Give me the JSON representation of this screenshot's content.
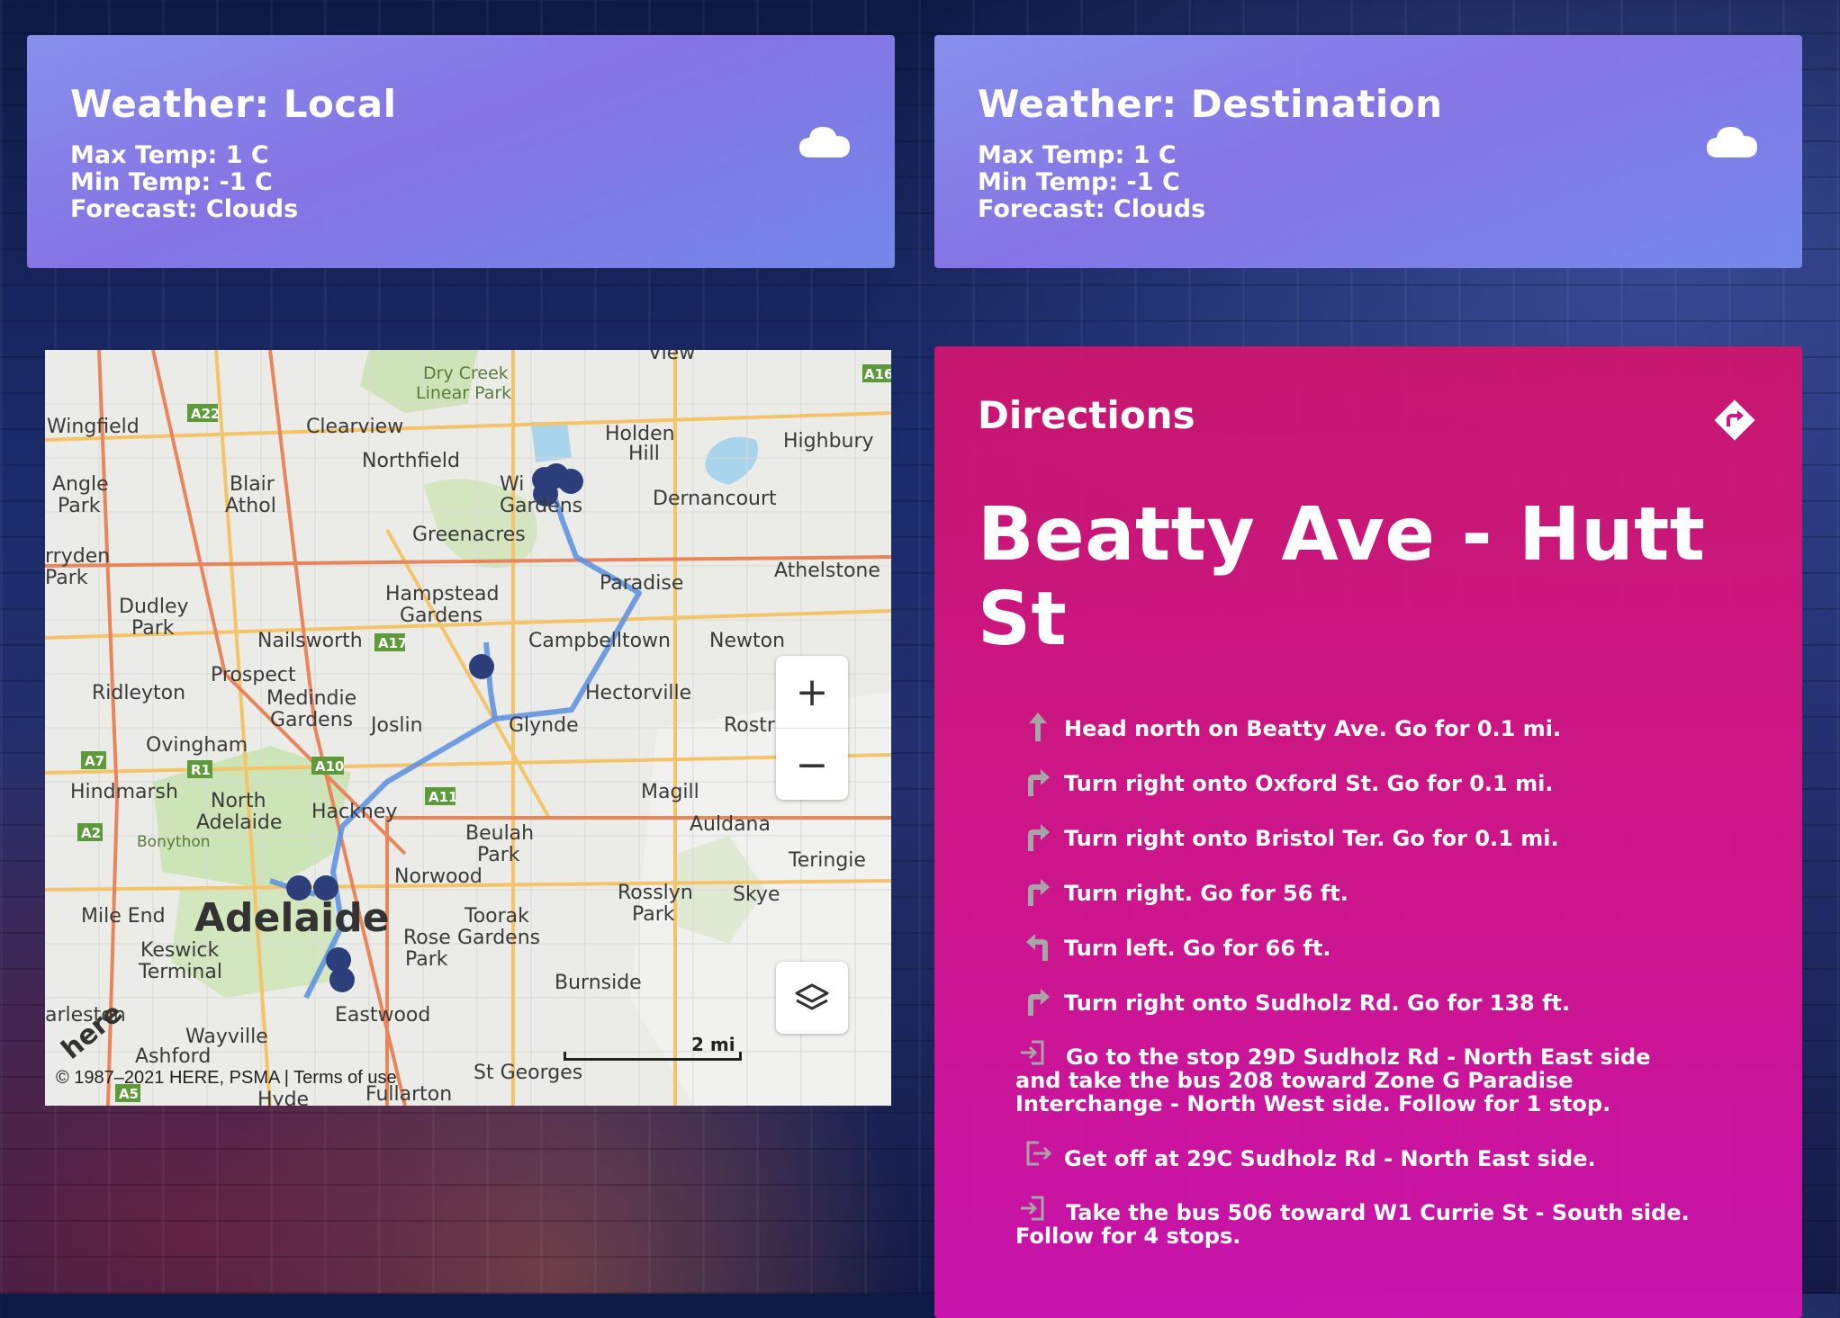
{
  "weather_local": {
    "title": "Weather: Local",
    "max_temp": "Max Temp: 1 C",
    "min_temp": "Min Temp: -1 C",
    "forecast": "Forecast: Clouds",
    "icon": "cloud-icon"
  },
  "weather_destination": {
    "title": "Weather: Destination",
    "max_temp": "Max Temp: 1 C",
    "min_temp": "Min Temp: -1 C",
    "forecast": "Forecast: Clouds",
    "icon": "cloud-icon"
  },
  "map": {
    "labels": {
      "dry_creek": "Dry Creek",
      "linear_park": "Linear Park",
      "wingfield": "Wingfield",
      "clearview": "Clearview",
      "holden": "Holden",
      "hill": "Hill",
      "highbury": "Highbury",
      "northfield": "Northfield",
      "angle": "Angle",
      "park": "Park",
      "blair": "Blair",
      "athol": "Athol",
      "gardens": "Gardens",
      "dernancourt": "Dernancourt",
      "greenacres": "Greenacres",
      "athelstone": "Athelstone",
      "ryden": "rryden",
      "dudley": "Dudley",
      "hampstead": "Hampstead",
      "paradise": "Paradise",
      "nailsworth": "Nailsworth",
      "campbelltown": "Campbelltown",
      "newton": "Newton",
      "prospect": "Prospect",
      "ridleyton": "Ridleyton",
      "medindie": "Medindie",
      "hectorville": "Hectorville",
      "joslin": "Joslin",
      "glynde": "Glynde",
      "rostr": "Rostr",
      "ovingham": "Ovingham",
      "magill": "Magill",
      "hindmarsh": "Hindmarsh",
      "north": "North",
      "adelaide_n": "Adelaide",
      "hackney": "Hackney",
      "auldana": "Auldana",
      "bonython": "Bonython",
      "beulah": "Beulah",
      "teringie": "Teringie",
      "norwood": "Norwood",
      "rosslyn": "Rosslyn",
      "mile_end": "Mile End",
      "adelaide": "Adelaide",
      "skye": "Skye",
      "keswick": "Keswick",
      "terminal": "Terminal",
      "toorak": "Toorak",
      "rose": "Rose",
      "burnside": "Burnside",
      "eastwood": "Eastwood",
      "arleston": "arleston",
      "wayville": "Wayville",
      "ashford": "Ashford",
      "st_georges": "St Georges",
      "fullarton": "Fullarton",
      "hyde": "Hyde",
      "view": "View",
      "wi": "Wi",
      "gardens2": "Gardens"
    },
    "road_labels": [
      "A22",
      "A17",
      "A7",
      "R1",
      "A10",
      "A11",
      "A2",
      "A5",
      "A16"
    ],
    "copyright": "© 1987–2021 HERE, PSMA | Terms of use",
    "scale": "2 mi",
    "logo": "here"
  },
  "directions": {
    "heading": "Directions",
    "route_title": "Beatty Ave - Hutt St",
    "steps": [
      {
        "icon": "arrow-up-icon",
        "text": "Head north on Beatty Ave. Go for 0.1 mi."
      },
      {
        "icon": "turn-right-icon",
        "text": "Turn right onto Oxford St. Go for 0.1 mi."
      },
      {
        "icon": "turn-right-icon",
        "text": "Turn right onto Bristol Ter. Go for 0.1 mi."
      },
      {
        "icon": "turn-right-icon",
        "text": "Turn right. Go for 56 ft."
      },
      {
        "icon": "turn-left-icon",
        "text": "Turn left. Go for 66 ft."
      },
      {
        "icon": "turn-right-icon",
        "text": "Turn right onto Sudholz Rd. Go for 138 ft."
      },
      {
        "icon": "board-icon",
        "text": "Go to the stop 29D Sudholz Rd - North East side and take the bus 208 toward Zone G Paradise Interchange - North West side. Follow for 1 stop."
      },
      {
        "icon": "exit-icon",
        "text": "Get off at 29C Sudholz Rd - North East side."
      },
      {
        "icon": "board-icon",
        "text": "Take the bus 506 toward W1 Currie St - South side. Follow for 4 stops."
      }
    ]
  },
  "colors": {
    "weather_card": "#8b88f0",
    "directions_card": "#d0168a",
    "route_line": "#5b8fe0",
    "route_dot": "#2c3f7a"
  }
}
